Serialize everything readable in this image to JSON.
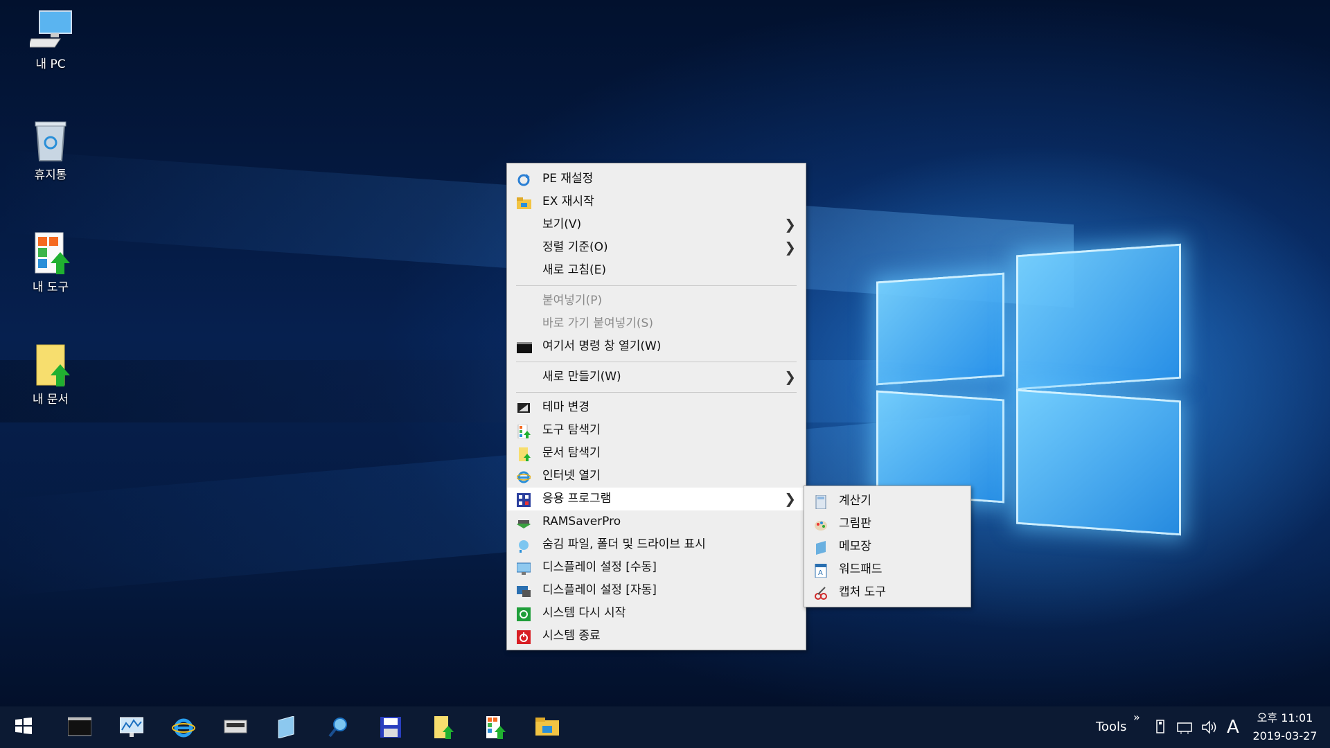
{
  "desktop": {
    "icons": [
      {
        "label": "내 PC",
        "icon": "computer-icon"
      },
      {
        "label": "휴지통",
        "icon": "recycle-bin-icon"
      },
      {
        "label": "내 도구",
        "icon": "my-tools-icon"
      },
      {
        "label": "내 문서",
        "icon": "my-documents-icon"
      }
    ]
  },
  "context_menu": {
    "items": [
      {
        "label": "PE 재설정",
        "icon": "refresh-icon"
      },
      {
        "label": "EX 재시작",
        "icon": "explorer-folder-icon"
      },
      {
        "label": "보기(V)",
        "submenu": true
      },
      {
        "label": "정렬 기준(O)",
        "submenu": true
      },
      {
        "label": "새로 고침(E)"
      },
      {
        "label": "붙여넣기(P)",
        "disabled": true
      },
      {
        "label": "바로 가기 붙여넣기(S)",
        "disabled": true
      },
      {
        "label": "여기서 명령 창 열기(W)",
        "icon": "command-prompt-icon"
      },
      {
        "label": "새로 만들기(W)",
        "submenu": true
      },
      {
        "label": "테마 변경",
        "icon": "theme-icon"
      },
      {
        "label": "도구 탐색기",
        "icon": "tools-explorer-icon"
      },
      {
        "label": "문서 탐색기",
        "icon": "document-explorer-icon"
      },
      {
        "label": "인터넷 열기",
        "icon": "internet-explorer-icon"
      },
      {
        "label": "응용 프로그램",
        "icon": "applications-icon",
        "submenu": true
      },
      {
        "label": "RAMSaverPro",
        "icon": "ramsaver-icon"
      },
      {
        "label": "숨김 파일, 폴더 및 드라이브 표시",
        "icon": "show-hidden-icon"
      },
      {
        "label": "디스플레이 설정 [수동]",
        "icon": "display-manual-icon"
      },
      {
        "label": "디스플레이 설정 [자동]",
        "icon": "display-auto-icon"
      },
      {
        "label": "시스템 다시 시작",
        "icon": "restart-icon"
      },
      {
        "label": "시스템 종료",
        "icon": "shutdown-icon"
      }
    ]
  },
  "submenu": {
    "items": [
      {
        "label": "계산기",
        "icon": "calculator-icon"
      },
      {
        "label": "그림판",
        "icon": "paint-icon"
      },
      {
        "label": "메모장",
        "icon": "notepad-icon"
      },
      {
        "label": "워드패드",
        "icon": "wordpad-icon"
      },
      {
        "label": "캡처 도구",
        "icon": "snipping-tool-icon"
      }
    ]
  },
  "taskbar": {
    "tools_label": "Tools",
    "chevron": "»",
    "ime": "A",
    "time": "오후 11:01",
    "date": "2019-03-27"
  }
}
